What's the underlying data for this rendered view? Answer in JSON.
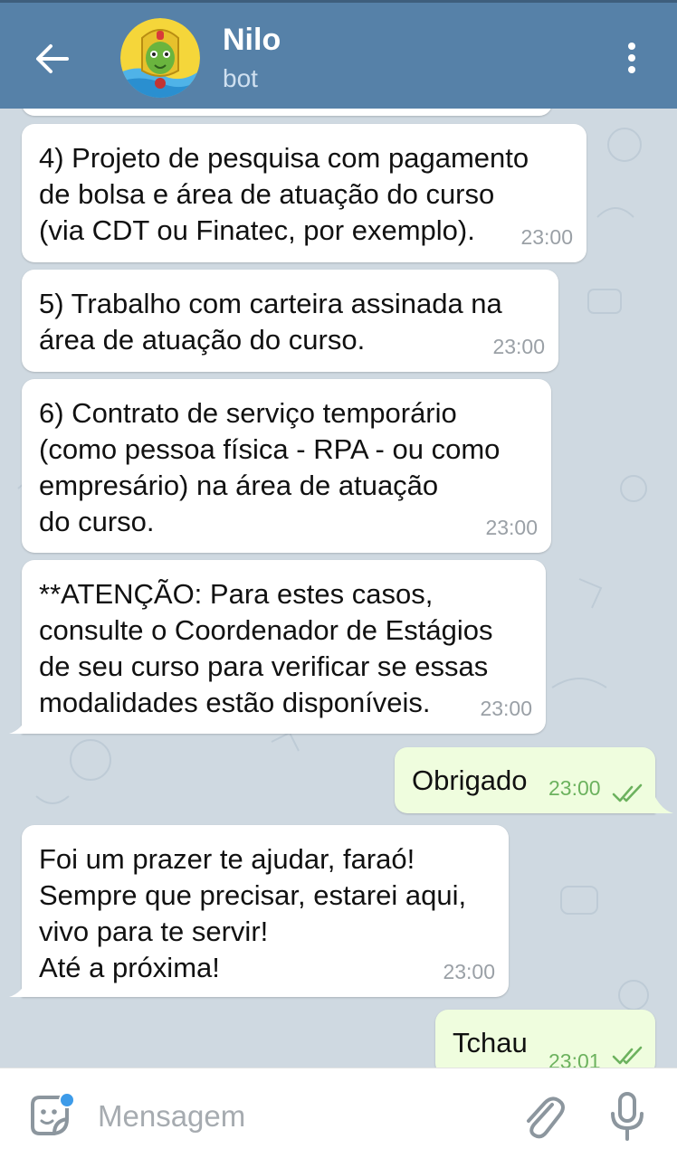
{
  "header": {
    "title": "Nilo",
    "subtitle": "bot"
  },
  "composer": {
    "placeholder": "Mensagem"
  },
  "messages": [
    {
      "direction": "in",
      "lines": [
        "4) Projeto de pesquisa com pagamento",
        "de bolsa e área de atuação do curso",
        "(via CDT ou Finatec, por exemplo)."
      ],
      "time": "23:00"
    },
    {
      "direction": "in",
      "lines": [
        "5) Trabalho com carteira assinada na",
        "área de atuação do curso."
      ],
      "time": "23:00"
    },
    {
      "direction": "in",
      "lines": [
        "6) Contrato de serviço temporário",
        "(como pessoa física - RPA - ou como",
        "empresário) na área de atuação",
        "do curso."
      ],
      "time": "23:00"
    },
    {
      "direction": "in",
      "lines": [
        "**ATENÇÃO: Para estes casos,",
        "consulte o Coordenador de Estágios",
        "de seu curso para verificar se essas",
        "modalidades estão disponíveis."
      ],
      "time": "23:00"
    },
    {
      "direction": "out",
      "lines": [
        "Obrigado"
      ],
      "time": "23:00",
      "status": "read"
    },
    {
      "direction": "in",
      "lines": [
        "Foi um prazer te ajudar, faraó!",
        "Sempre que precisar, estarei aqui,",
        "vivo para te servir!",
        "Até a próxima!"
      ],
      "time": "23:00"
    },
    {
      "direction": "out",
      "lines": [
        "Tchau"
      ],
      "time": "23:01",
      "status": "read"
    }
  ],
  "colors": {
    "header": "#5681a8",
    "incoming": "#ffffff",
    "outgoing": "#effdde",
    "read_ticks": "#6cb25e",
    "badge": "#3d9be9"
  },
  "icons": {
    "back": "arrow-left-icon",
    "menu": "more-vertical-icon",
    "sticker": "sticker-icon",
    "attach": "paperclip-icon",
    "mic": "microphone-icon"
  }
}
